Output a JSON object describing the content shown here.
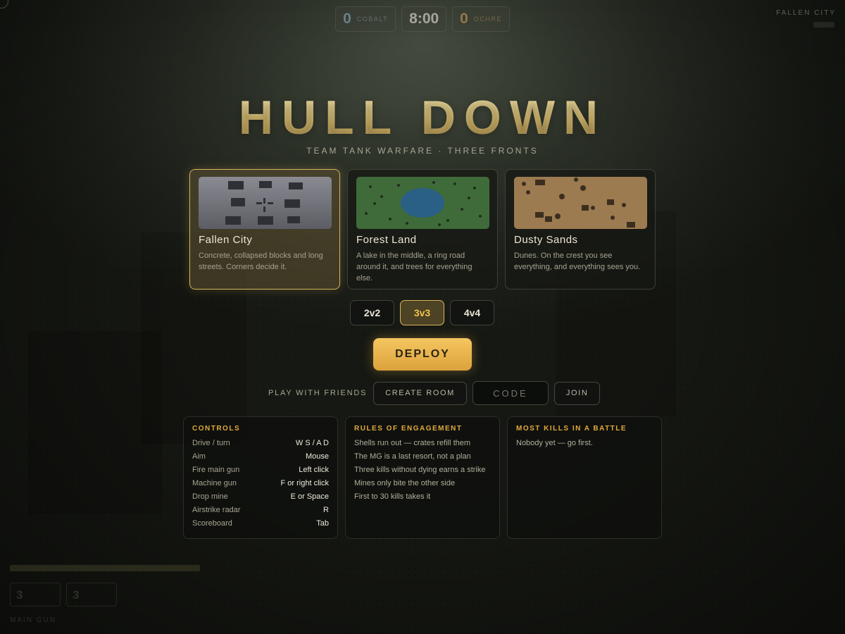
{
  "hud": {
    "teams": [
      {
        "score": "0",
        "label": "COBALT"
      },
      {
        "score": "0",
        "label": "OCHRE"
      }
    ],
    "timer": "8:00",
    "map_name": "FALLEN CITY",
    "bottom": {
      "cells": [
        "3",
        "3",
        ""
      ],
      "label": "MAIN GUN"
    }
  },
  "title": "HULL DOWN",
  "subtitle": "TEAM TANK WARFARE · THREE FRONTS",
  "maps": [
    {
      "name": "Fallen City",
      "description": "Concrete, collapsed blocks and long streets. Corners decide it.",
      "selected": true
    },
    {
      "name": "Forest Land",
      "description": "A lake in the middle, a ring road around it, and trees for everything else.",
      "selected": false
    },
    {
      "name": "Dusty Sands",
      "description": "Dunes. On the crest you see everything, and everything sees you.",
      "selected": false
    }
  ],
  "team_sizes": [
    {
      "label": "2v2",
      "selected": false
    },
    {
      "label": "3v3",
      "selected": true
    },
    {
      "label": "4v4",
      "selected": false
    }
  ],
  "deploy_label": "DEPLOY",
  "friends": {
    "label": "PLAY WITH FRIENDS",
    "create_room": "CREATE ROOM",
    "code_placeholder": "CODE",
    "code_value": "",
    "join": "JOIN"
  },
  "controls": {
    "title": "CONTROLS",
    "rows": [
      {
        "action": "Drive / turn",
        "key": "W S / A D"
      },
      {
        "action": "Aim",
        "key": "Mouse"
      },
      {
        "action": "Fire main gun",
        "key": "Left click"
      },
      {
        "action": "Machine gun",
        "key": "F or right click"
      },
      {
        "action": "Drop mine",
        "key": "E or Space"
      },
      {
        "action": "Airstrike radar",
        "key": "R"
      },
      {
        "action": "Scoreboard",
        "key": "Tab"
      }
    ]
  },
  "rules": {
    "title": "RULES OF ENGAGEMENT",
    "items": [
      "Shells run out — crates refill them",
      "The MG is a last resort, not a plan",
      "Three kills without dying earns a strike",
      "Mines only bite the other side",
      "First to 30 kills takes it"
    ]
  },
  "kills": {
    "title": "MOST KILLS IN A BATTLE",
    "empty": "Nobody yet — go first."
  },
  "colors": {
    "accent": "#e2a93c",
    "gold": "#d6b45a",
    "deploy": "#f0b84c",
    "cobalt": "#7c93a8",
    "ochre": "#b08a52"
  }
}
